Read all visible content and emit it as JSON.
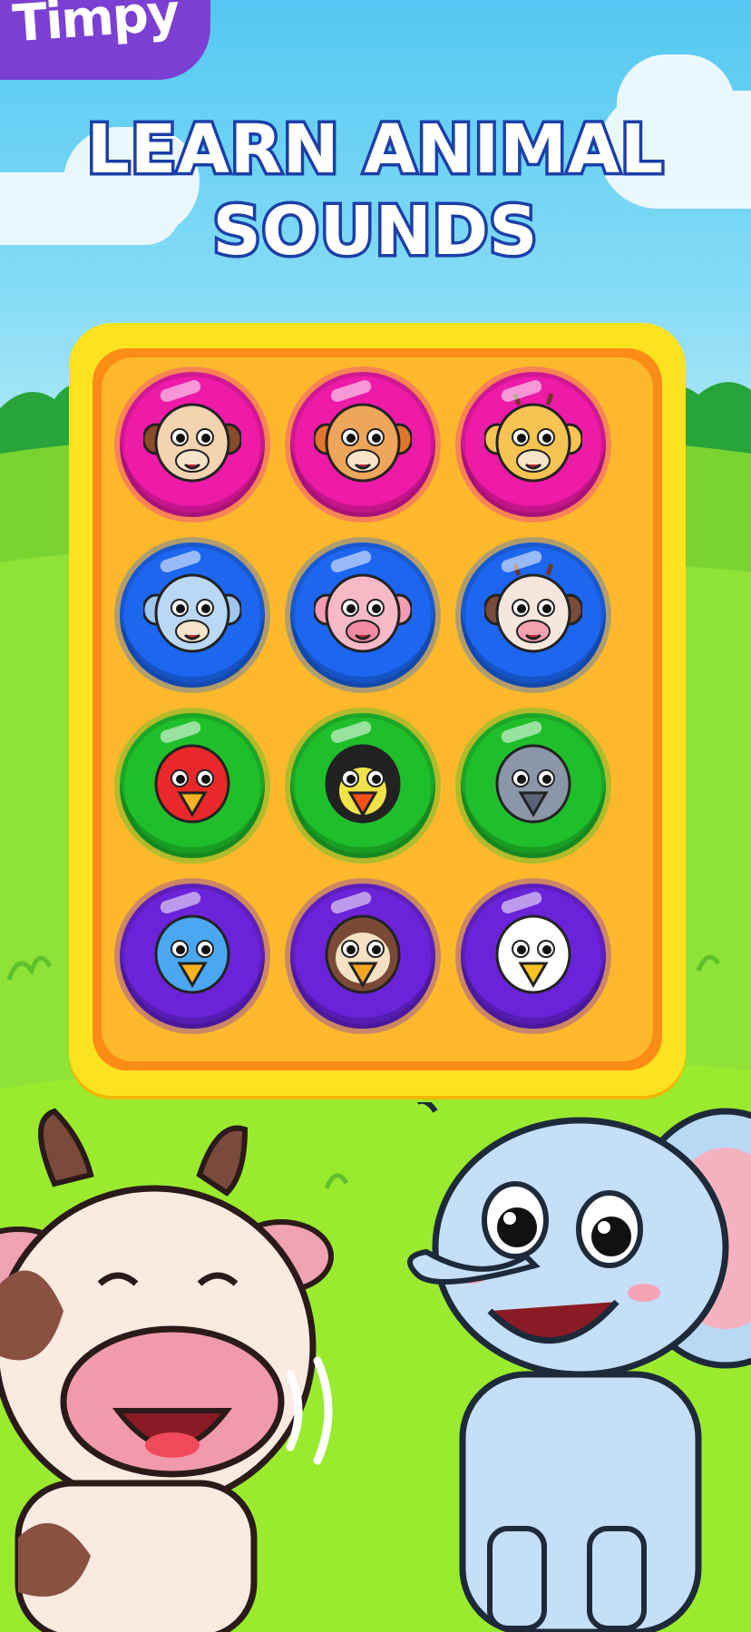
{
  "app": {
    "logo": "Timpy"
  },
  "headline": {
    "line1": "LEARN ANIMAL",
    "line2": "SOUNDS"
  },
  "colors": {
    "sky": "#63cdf3",
    "grass": "#8ee238",
    "board_yellow": "#fde21f",
    "board_orange": "#fb8c15",
    "pink": "#ee1aa8",
    "blue": "#1c66f0",
    "green": "#1fbf2c",
    "purple": "#6a23d8",
    "logo_purple": "#7b3fd3",
    "title_outline": "#1b3fa8"
  },
  "buttons": [
    {
      "animal": "monkey",
      "icon": "monkey-icon",
      "color": "pink"
    },
    {
      "animal": "dog",
      "icon": "dog-icon",
      "color": "pink"
    },
    {
      "animal": "giraffe",
      "icon": "giraffe-icon",
      "color": "pink"
    },
    {
      "animal": "elephant",
      "icon": "elephant-icon",
      "color": "blue"
    },
    {
      "animal": "pig",
      "icon": "pig-icon",
      "color": "blue"
    },
    {
      "animal": "cow",
      "icon": "cow-icon",
      "color": "blue"
    },
    {
      "animal": "parrot",
      "icon": "parrot-icon",
      "color": "green"
    },
    {
      "animal": "toucan",
      "icon": "toucan-icon",
      "color": "green"
    },
    {
      "animal": "pigeon",
      "icon": "pigeon-icon",
      "color": "green"
    },
    {
      "animal": "bluebird",
      "icon": "bluebird-icon",
      "color": "purple"
    },
    {
      "animal": "owl",
      "icon": "owl-icon",
      "color": "purple"
    },
    {
      "animal": "goose",
      "icon": "goose-icon",
      "color": "purple"
    }
  ],
  "characters": {
    "left": "cow-character",
    "right": "elephant-character"
  }
}
